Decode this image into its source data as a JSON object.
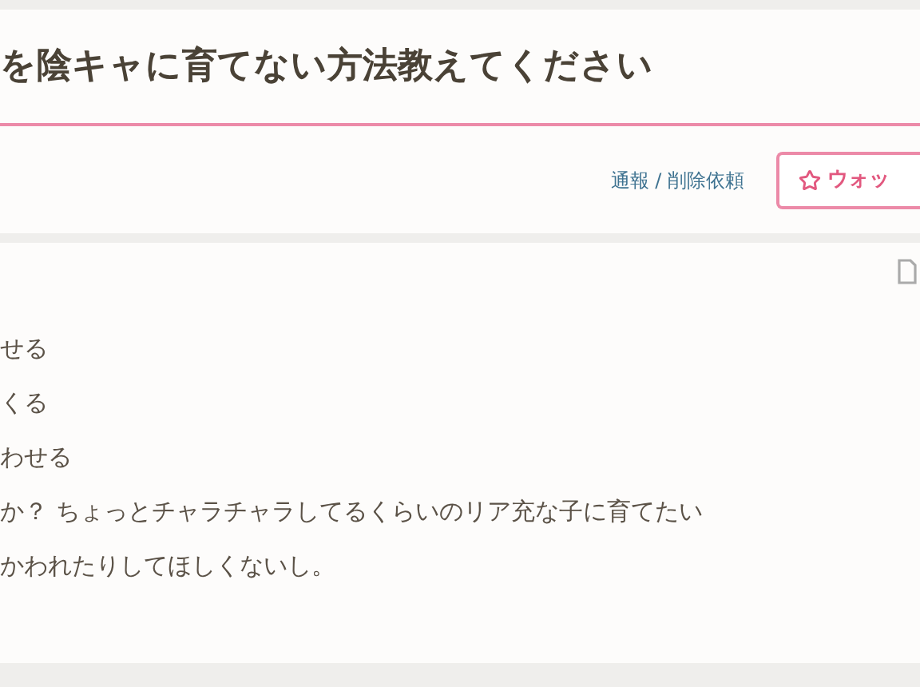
{
  "question": {
    "title": "を陰キャに育てない方法教えてください"
  },
  "actions": {
    "report_link": "通報 / 削除依頼",
    "watch_button": "ウォッ"
  },
  "body": {
    "lines": [
      "せる",
      "くる",
      "わせる",
      "か？ ちょっとチャラチャラしてるくらいのリア充な子に育てたい",
      "かわれたりしてほしくないし。"
    ]
  }
}
